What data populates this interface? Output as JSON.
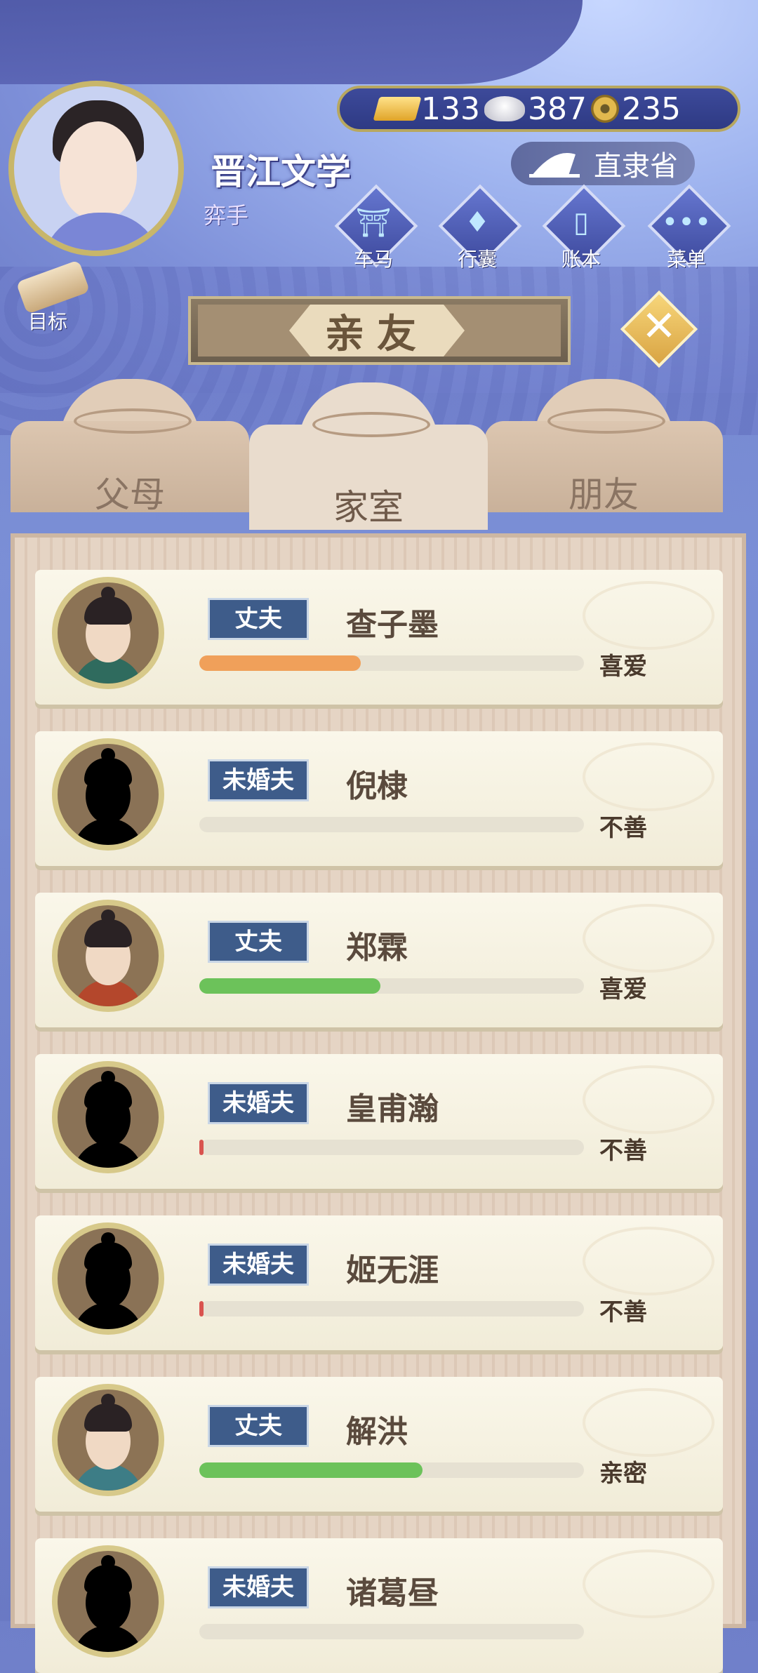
{
  "player": {
    "name": "晋江文学",
    "rank": "弈手"
  },
  "currency": {
    "gold": "133",
    "silver": "387",
    "coins": "235"
  },
  "location": "直隶省",
  "menu": [
    {
      "label": "车马",
      "icon": "carriage-icon"
    },
    {
      "label": "行囊",
      "icon": "bag-icon"
    },
    {
      "label": "账本",
      "icon": "ledger-icon"
    },
    {
      "label": "菜单",
      "icon": "more-icon"
    }
  ],
  "goal_label": "目标",
  "title": "亲友",
  "tabs": [
    {
      "label": "父母",
      "active": false
    },
    {
      "label": "家室",
      "active": true
    },
    {
      "label": "朋友",
      "active": false
    }
  ],
  "relations": [
    {
      "role": "丈夫",
      "name": "查子墨",
      "status": "喜爱",
      "affinity": 0.42,
      "bar_color": "#f0a05a",
      "portrait": "man-1"
    },
    {
      "role": "未婚夫",
      "name": "倪棣",
      "status": "不善",
      "affinity": 0.0,
      "bar_color": "#d9534f",
      "portrait": "silhouette"
    },
    {
      "role": "丈夫",
      "name": "郑霖",
      "status": "喜爱",
      "affinity": 0.47,
      "bar_color": "#6cc25a",
      "portrait": "man-2"
    },
    {
      "role": "未婚夫",
      "name": "皇甫瀚",
      "status": "不善",
      "affinity": 0.01,
      "bar_color": "#d9534f",
      "portrait": "silhouette"
    },
    {
      "role": "未婚夫",
      "name": "姬无涯",
      "status": "不善",
      "affinity": 0.01,
      "bar_color": "#d9534f",
      "portrait": "silhouette"
    },
    {
      "role": "丈夫",
      "name": "解洪",
      "status": "亲密",
      "affinity": 0.58,
      "bar_color": "#6cc25a",
      "portrait": "man-3"
    },
    {
      "role": "未婚夫",
      "name": "诸葛昼",
      "status": "",
      "affinity": 0.0,
      "bar_color": "#d9534f",
      "portrait": "silhouette"
    }
  ],
  "colors": {
    "badge": "#3e5c8a",
    "accent_gold": "#d9a443",
    "panel": "#e5d4c4"
  }
}
